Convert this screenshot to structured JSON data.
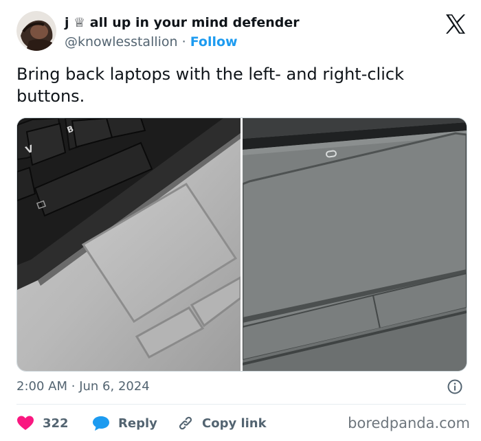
{
  "author": {
    "display_name": "j ♕ all up in your mind defender",
    "handle": "@knowlesstallion",
    "separator": "·",
    "follow_label": "Follow"
  },
  "tweet": {
    "text": "Bring back laptops with the left- and right-click buttons."
  },
  "timestamp": {
    "time": "2:00 AM",
    "separator": "·",
    "date": "Jun 6, 2024"
  },
  "actions": {
    "like_count": "322",
    "reply_label": "Reply",
    "copy_link_label": "Copy link"
  },
  "photo_keys": [
    "V",
    "B"
  ],
  "watermark": "boredpanda.com",
  "colors": {
    "accent": "#1d9bf0",
    "like": "#f91880",
    "reply": "#1d9bf0",
    "muted": "#536471"
  },
  "icons": [
    "x-logo-icon",
    "info-icon",
    "heart-icon",
    "reply-bubble-icon",
    "link-icon"
  ]
}
